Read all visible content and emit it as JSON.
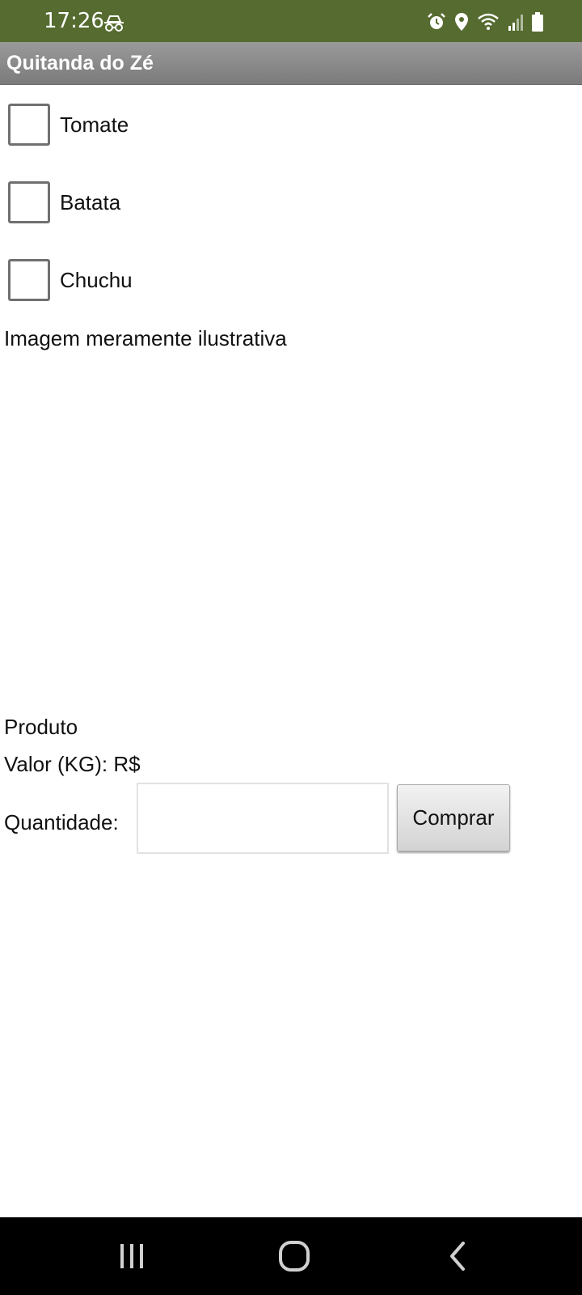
{
  "status_bar": {
    "time": "17:26",
    "icons": [
      "incognito-icon",
      "alarm-icon",
      "location-icon",
      "wifi-icon",
      "signal-icon",
      "battery-icon"
    ],
    "background": "#556B2F"
  },
  "app_bar": {
    "title": "Quitanda do Zé"
  },
  "products": [
    {
      "label": "Tomate",
      "checked": false
    },
    {
      "label": "Batata",
      "checked": false
    },
    {
      "label": "Chuchu",
      "checked": false
    }
  ],
  "image_caption": "Imagem meramente ilustrativa",
  "details": {
    "product_label": "Produto",
    "price_label": "Valor (KG): R$",
    "quantity_label": "Quantidade:",
    "quantity_value": "",
    "buy_button": "Comprar"
  },
  "nav_bar": {
    "buttons": [
      "recent-apps-icon",
      "home-icon",
      "back-icon"
    ]
  }
}
